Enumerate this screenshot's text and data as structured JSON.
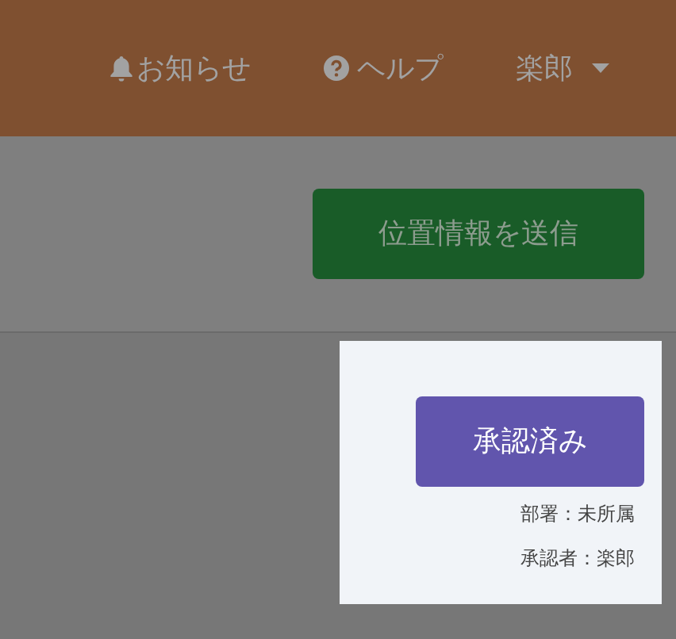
{
  "header": {
    "items": [
      {
        "kind": "bell",
        "label": "お知らせ"
      },
      {
        "kind": "help",
        "label": "ヘルプ"
      },
      {
        "kind": "user",
        "label": "楽郎"
      }
    ]
  },
  "location_button": "位置情報を送信",
  "approval_card": {
    "status_button": "承認済み",
    "department": "部署：未所属",
    "approver": "承認者：楽郎"
  }
}
